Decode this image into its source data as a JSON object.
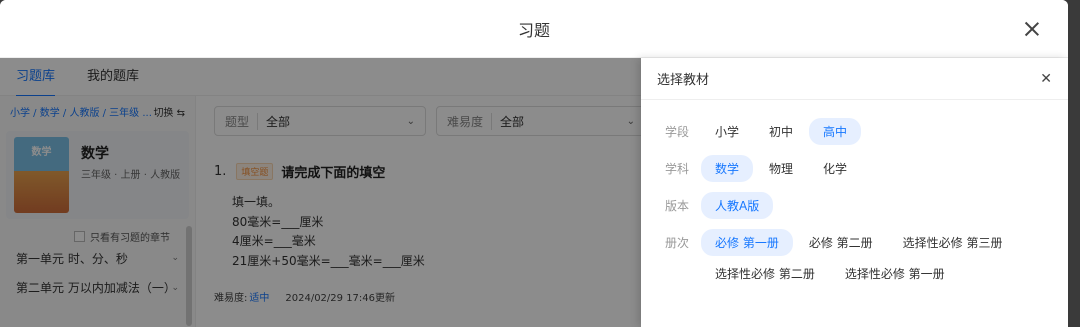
{
  "modal": {
    "title": "习题"
  },
  "tabs": [
    "习题库",
    "我的题库"
  ],
  "left": {
    "breadcrumb": "小学 / 数学 / 人教版 / 三年级 ...",
    "switch": "切换 ⇆",
    "book": {
      "cover_text": "数学",
      "title": "数学",
      "meta": "三年级 · 上册 · 人教版"
    },
    "only_chapters": "只看有习题的章节",
    "chapters": [
      "第一单元 时、分、秒",
      "第二单元 万以内加减法（一）"
    ]
  },
  "filters": [
    {
      "label": "题型",
      "value": "全部"
    },
    {
      "label": "难易度",
      "value": "全部"
    }
  ],
  "question": {
    "number": "1.",
    "badge": "填空题",
    "title": "请完成下面的填空",
    "lines": [
      "填一填。",
      "80毫米=___厘米",
      "4厘米=___毫米",
      "21厘米+50毫米=___毫米=___厘米"
    ],
    "difficulty_label": "难易度:",
    "difficulty": "适中",
    "updated": "2024/02/29 17:46更新"
  },
  "side": {
    "title": "选择教材",
    "rows": [
      {
        "label": "学段",
        "options": [
          "小学",
          "初中",
          "高中"
        ],
        "selected": 2
      },
      {
        "label": "学科",
        "options": [
          "数学",
          "物理",
          "化学"
        ],
        "selected": 0
      },
      {
        "label": "版本",
        "options": [
          "人教A版"
        ],
        "selected": 0
      },
      {
        "label": "册次",
        "options": [
          "必修 第一册",
          "必修 第二册",
          "选择性必修 第三册"
        ],
        "selected": 0
      },
      {
        "label": "",
        "options": [
          "选择性必修 第二册",
          "选择性必修 第一册"
        ],
        "selected": -1
      }
    ]
  }
}
